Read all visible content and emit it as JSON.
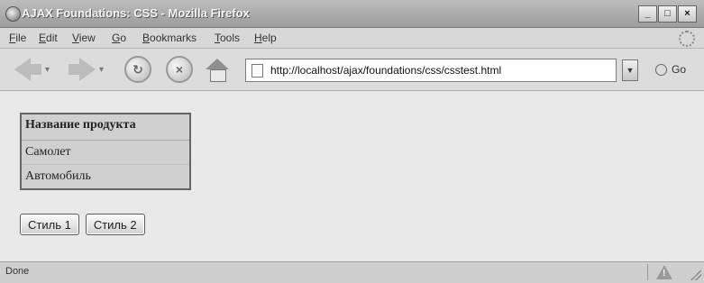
{
  "window": {
    "title": "AJAX Foundations: CSS - Mozilla Firefox",
    "controls": [
      "_",
      "□",
      "×"
    ]
  },
  "menu": {
    "items": [
      "File",
      "Edit",
      "View",
      "Go",
      "Bookmarks",
      "Tools",
      "Help"
    ],
    "underlined": [
      "F",
      "E",
      "V",
      "G",
      "B",
      "T",
      "H"
    ]
  },
  "nav": {
    "url": "http://localhost/ajax/foundations/css/csstest.html",
    "go_label": "Go",
    "icons": [
      "back-arrow-icon",
      "forward-arrow-icon",
      "reload-icon",
      "stop-icon",
      "home-icon"
    ]
  },
  "content": {
    "table_header": "Название продукта",
    "rows": [
      "Самолет",
      "Автомобиль"
    ],
    "buttons": [
      "Стиль 1",
      "Стиль 2"
    ]
  },
  "status": {
    "text": "Done"
  },
  "colors": {
    "titlebar": "#9c9c9c",
    "table_bg": "#d0d0d0",
    "page_bg": "#e9e9e9"
  }
}
